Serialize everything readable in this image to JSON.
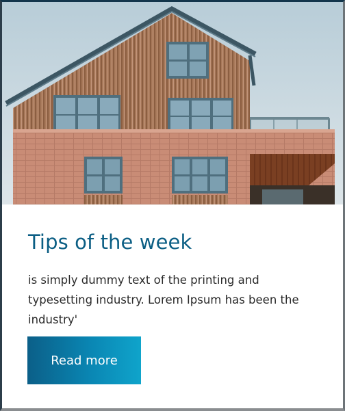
{
  "card": {
    "image_alt": "Photo of a modern brick and wood-clad house",
    "title": "Tips of the week",
    "description": "is simply dummy text of the printing and typesetting industry. Lorem Ipsum has been the industry'",
    "button_label": "Read more"
  },
  "colors": {
    "title": "#0b5e84",
    "button_gradient_start": "#0b5f88",
    "button_gradient_end": "#0fa4cb",
    "body_text": "#2a2a2a"
  }
}
